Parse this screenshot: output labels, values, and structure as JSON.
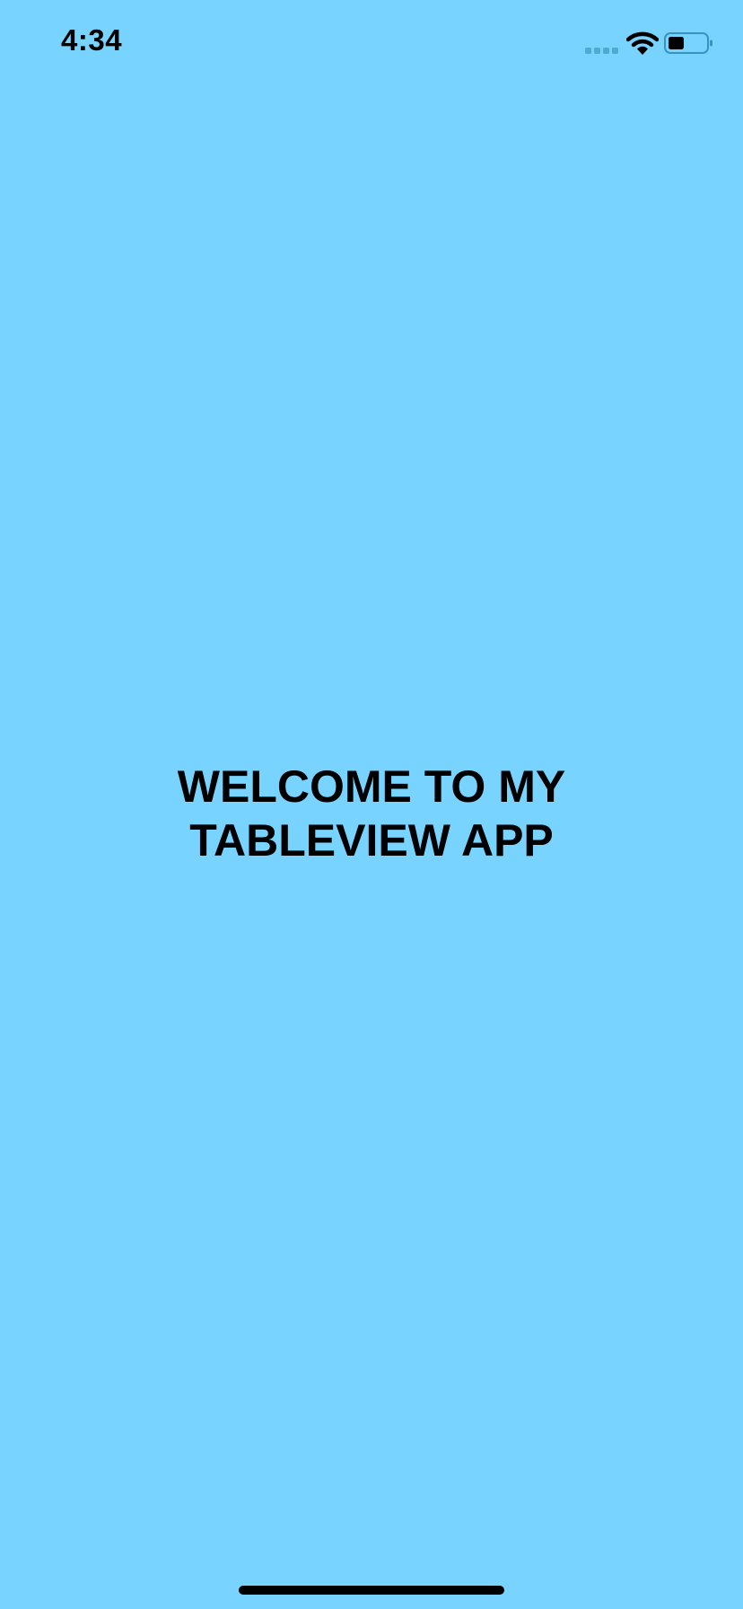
{
  "status_bar": {
    "time": "4:34",
    "icons": [
      "cellular-signal-icon",
      "wifi-icon",
      "battery-icon"
    ]
  },
  "main": {
    "welcome_line1": "WELCOME TO MY",
    "welcome_line2": "TABLEVIEW APP"
  },
  "colors": {
    "background": "#78D4FF",
    "text": "#000000"
  }
}
